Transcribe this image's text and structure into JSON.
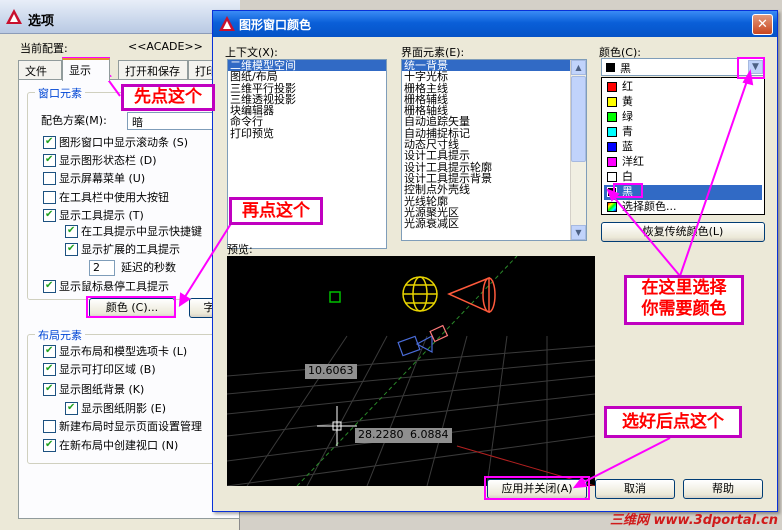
{
  "options": {
    "title": "选项",
    "current_profile_label": "当前配置:",
    "current_profile_value": "<<ACADE>>",
    "tabs": [
      "文件",
      "显示",
      "打开和保存",
      "打印"
    ],
    "window_elements": {
      "heading": "窗口元素",
      "scheme_label": "配色方案(M):",
      "scheme_value": "暗",
      "items": [
        {
          "label": "图形窗口中显示滚动条 (S)",
          "checked": true
        },
        {
          "label": "显示图形状态栏 (D)",
          "checked": true
        },
        {
          "label": "显示屏幕菜单 (U)",
          "checked": false
        },
        {
          "label": "在工具栏中使用大按钮",
          "checked": false
        },
        {
          "label": "显示工具提示 (T)",
          "checked": true
        },
        {
          "label": "在工具提示中显示快捷键",
          "checked": true
        },
        {
          "label": "显示扩展的工具提示",
          "checked": true
        },
        {
          "label": "显示鼠标悬停工具提示",
          "checked": true
        }
      ],
      "delay_value": "2",
      "delay_label": "延迟的秒数",
      "colors_button": "颜色 (C)...",
      "fonts_button": "字"
    },
    "layout_elements": {
      "heading": "布局元素",
      "items": [
        {
          "label": "显示布局和模型选项卡 (L)",
          "checked": true
        },
        {
          "label": "显示可打印区域 (B)",
          "checked": true
        },
        {
          "label": "显示图纸背景 (K)",
          "checked": true
        },
        {
          "label": "显示图纸阴影 (E)",
          "checked": true
        },
        {
          "label": "新建布局时显示页面设置管理",
          "checked": false
        },
        {
          "label": "在新布局中创建视口 (N)",
          "checked": true
        }
      ]
    }
  },
  "dialog": {
    "title": "图形窗口颜色",
    "context_label": "上下文(X):",
    "context_items": [
      "二维模型空间",
      "图纸/布局",
      "三维平行投影",
      "三维透视投影",
      "块编辑器",
      "命令行",
      "打印预览"
    ],
    "context_selected": 0,
    "interface_label": "界面元素(E):",
    "interface_items": [
      "统一背景",
      "十字光标",
      "栅格主线",
      "栅格辅线",
      "栅格轴线",
      "自动追踪矢量",
      "自动捕捉标记",
      "动态尺寸线",
      "设计工具提示",
      "设计工具提示轮廓",
      "设计工具提示背景",
      "控制点外壳线",
      "光线轮廓",
      "光源聚光区",
      "光源衰减区"
    ],
    "interface_selected": 0,
    "color_label": "颜色(C):",
    "color_value": "黑",
    "color_options": [
      {
        "name": "红",
        "color": "#ff0000"
      },
      {
        "name": "黄",
        "color": "#ffff00"
      },
      {
        "name": "绿",
        "color": "#00ff00"
      },
      {
        "name": "青",
        "color": "#00ffff"
      },
      {
        "name": "蓝",
        "color": "#0000ff"
      },
      {
        "name": "洋红",
        "color": "#ff00ff"
      },
      {
        "name": "白",
        "color": "#ffffff"
      },
      {
        "name": "黑",
        "color": "#000000"
      },
      {
        "name": "选择颜色...",
        "color": "multi"
      }
    ],
    "color_selected": 7,
    "restore_button": "恢复传统颜色(L)",
    "preview_label": "预览:",
    "preview_dim1": "10.6063",
    "preview_dim2": "28.2280",
    "preview_dim3": "6.0884",
    "apply_button": "应用并关闭(A)",
    "cancel_button": "取消",
    "help_button": "帮助"
  },
  "annotations": {
    "step1": "先点这个",
    "step2": "再点这个",
    "step3_line1": "在这里选择",
    "step3_line2": "你需要颜色",
    "step4": "选好后点这个",
    "accent": "#c000c0",
    "text_color": "#ff0000"
  },
  "watermark": "三维网 www.3dportal.cn"
}
